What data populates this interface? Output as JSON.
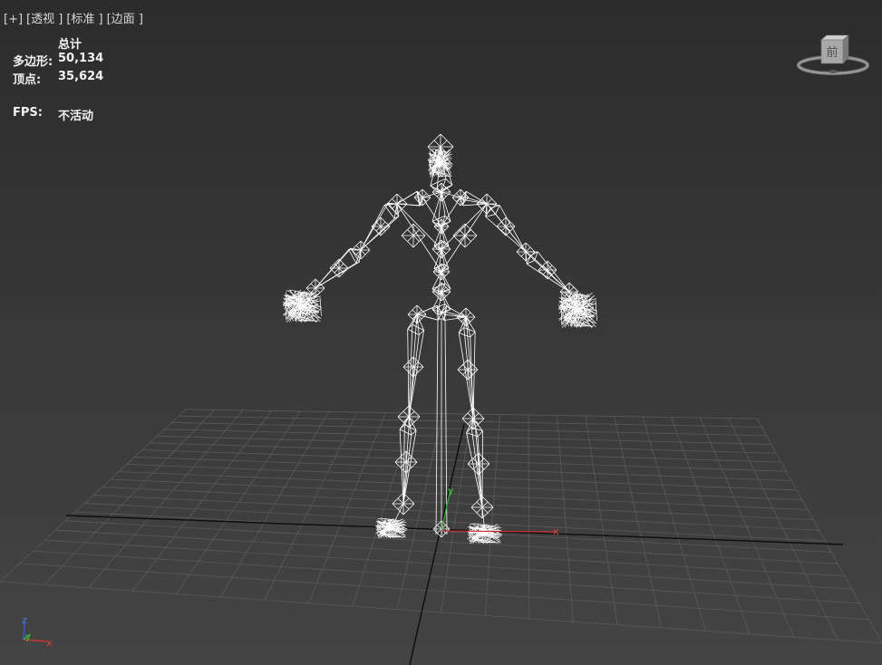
{
  "viewport": {
    "labels": {
      "view": "[+]",
      "projection": "[透视 ]",
      "shading_mode": "[标准 ]",
      "display_style": "[边面 ]"
    },
    "stats": {
      "header": "总计",
      "polygons_label": "多边形:",
      "polygons_value": "50,134",
      "vertices_label": "顶点:",
      "vertices_value": "35,624",
      "fps_label": "FPS:",
      "fps_value": "不活动"
    },
    "viewcube": {
      "face_label": "前"
    },
    "axis_tripod": {
      "z": "z",
      "y": "y",
      "x": "x"
    },
    "gizmo": {
      "x": "x",
      "y": "y"
    },
    "colors": {
      "background_top": "#2c2c2c",
      "background_bottom": "#444444",
      "grid": "#5a5a5a",
      "grid_axis": "#111111",
      "wireframe": "#ffffff",
      "axis_x": "#e03030",
      "axis_y": "#30c030",
      "axis_z": "#3060e0"
    }
  }
}
